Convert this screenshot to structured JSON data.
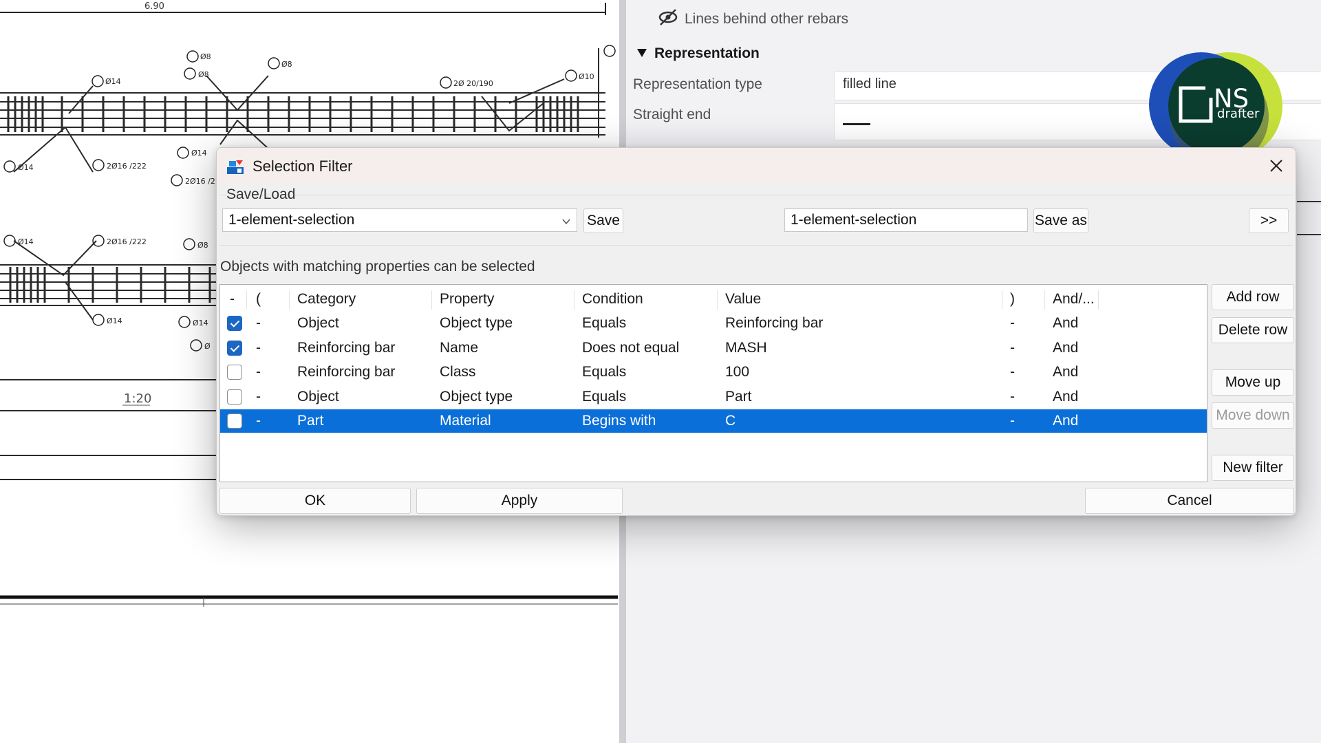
{
  "drawing": {
    "dimension": "6.90",
    "scale": "1:20",
    "bar_labels_top": [
      "Ø14",
      "Ø8",
      "Ø14",
      "Ø8",
      "2Ø 20/190",
      "Ø10",
      "Ø14",
      "2Ø16 /222",
      "Ø14",
      "2Ø16 /2"
    ],
    "bar_labels_bottom": [
      "Ø14",
      "2Ø16 /222",
      "Ø8",
      "Ø14",
      "Ø14",
      "Ø"
    ]
  },
  "properties": {
    "lines_behind": "Lines behind other rebars",
    "section_title": "Representation",
    "rep_type_label": "Representation type",
    "rep_type_value": "filled line",
    "straight_end_label": "Straight end"
  },
  "logo": {
    "ns": "NS",
    "drafter": "drafter"
  },
  "dialog": {
    "title": "Selection Filter",
    "save_load_label": "Save/Load",
    "load_combo_value": "1-element-selection",
    "save_button": "Save",
    "save_as_input_value": "1-element-selection",
    "save_as_button": "Save as",
    "expand_button": ">>",
    "info_text": "Objects with matching properties can be selected",
    "columns": [
      "-",
      "(",
      "Category",
      "Property",
      "Condition",
      "Value",
      ")",
      "And/..."
    ],
    "rows": [
      {
        "checked": true,
        "open": "-",
        "category": "Object",
        "property": "Object type",
        "condition": "Equals",
        "value": "Reinforcing bar",
        "close": "-",
        "andor": "And"
      },
      {
        "checked": true,
        "open": "-",
        "category": "Reinforcing bar",
        "property": "Name",
        "condition": "Does not equal",
        "value": "MASH",
        "close": "-",
        "andor": "And"
      },
      {
        "checked": false,
        "open": "-",
        "category": "Reinforcing bar",
        "property": "Class",
        "condition": "Equals",
        "value": "100",
        "close": "-",
        "andor": "And"
      },
      {
        "checked": false,
        "open": "-",
        "category": "Object",
        "property": "Object type",
        "condition": "Equals",
        "value": "Part",
        "close": "-",
        "andor": "And"
      },
      {
        "checked": false,
        "open": "-",
        "category": "Part",
        "property": "Material",
        "condition": "Begins with",
        "value": "C",
        "close": "-",
        "andor": "And",
        "selected": true
      }
    ],
    "add_row": "Add row",
    "delete_row": "Delete row",
    "move_up": "Move up",
    "move_down": "Move down",
    "new_filter": "New filter",
    "ok": "OK",
    "apply": "Apply",
    "cancel": "Cancel"
  },
  "colors": {
    "selection": "#0a6fd8",
    "checkbox_on": "#1b67c2",
    "logo_dark": "#0b3d2e",
    "logo_blue": "#1e4fb8",
    "logo_lime": "#c6e13c"
  },
  "icons": [
    "eye-off-icon",
    "triangle-down-icon",
    "selection-filter-icon",
    "close-icon",
    "chevron-down-icon",
    "checkbox-icon"
  ]
}
